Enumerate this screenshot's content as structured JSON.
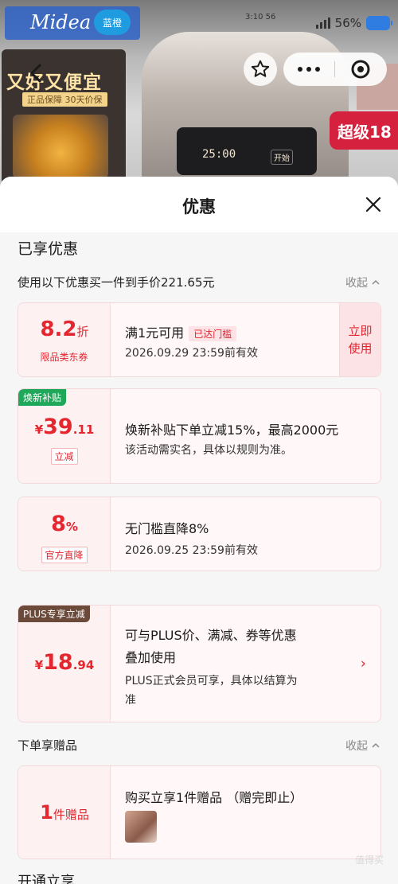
{
  "background": {
    "brand_logo_text": "Midea",
    "logo_badge": "蓝橙",
    "promo_title": "又好又便宜",
    "promo_subtitle": "正品保障 30天价保",
    "cooker_display": "25:00",
    "cooker_button": "开始",
    "red_tag": "超级18"
  },
  "status_bar": {
    "small_time": "3:10 56",
    "battery": "56%"
  },
  "sheet": {
    "title": "优惠",
    "section_title": "已享优惠",
    "summary_label": "使用以下优惠买一件到手价221.65元",
    "collapse_label": "收起",
    "coupons": [
      {
        "amount": "8.2",
        "amount_unit": "折",
        "type_tag": "限品类东券",
        "line1": "满1元可用",
        "inline_tag": "已达门槛",
        "line2": "2026.09.29 23:59前有效",
        "action": "立即\n使用"
      },
      {
        "corner_badge": "焕新补贴",
        "currency": "¥",
        "amount": "39",
        "amount_decimal": ".11",
        "type_tag": "立减",
        "line1": "焕新补贴下单立减15%，最高2000元",
        "line2": "该活动需实名，具体以规则为准。"
      },
      {
        "amount": "8",
        "amount_unit": "%",
        "type_tag": "官方直降",
        "line1": "无门槛直降8%",
        "line2": "2026.09.25 23:59前有效"
      },
      {
        "corner_badge": "PLUS专享立减",
        "currency": "¥",
        "amount": "18",
        "amount_decimal": ".94",
        "line1": "可与PLUS价、满减、券等优惠",
        "line1b": "叠加使用",
        "line2": "PLUS正式会员可享，具体以结算为",
        "line2b": "准"
      }
    ],
    "gift_section_label": "下单享赠品",
    "gift_collapse_label": "收起",
    "gift": {
      "amount": "1",
      "amount_unit": "件赠品",
      "line1": "购买立享1件赠品 （赠完即止）"
    },
    "next_section_title": "开通立享",
    "watermark": "值得买"
  },
  "colors": {
    "accent_red": "#e4262f",
    "green_badge": "#1fa85a",
    "plus_badge": "#6b4a3a"
  }
}
